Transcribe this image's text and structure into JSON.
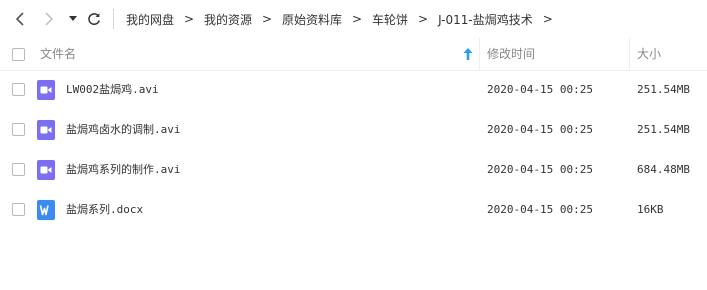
{
  "breadcrumb": [
    "我的网盘",
    "我的资源",
    "原始资料库",
    "车轮饼",
    "J-011-盐焗鸡技术"
  ],
  "breadcrumb_separator": ">",
  "columns": {
    "name": "文件名",
    "modified": "修改时间",
    "size": "大小"
  },
  "sort": {
    "column": "name",
    "direction": "ascending",
    "icon": "sort-up-arrow-icon"
  },
  "colors": {
    "video_icon": "#7b6ef0",
    "doc_icon": "#3b8cf2",
    "sort_arrow": "#2a9cf6"
  },
  "files": [
    {
      "name": "LW002盐焗鸡.avi",
      "modified": "2020-04-15 00:25",
      "size": "251.54MB",
      "icon": "video-file-icon"
    },
    {
      "name": "盐焗鸡卤水的调制.avi",
      "modified": "2020-04-15 00:25",
      "size": "251.54MB",
      "icon": "video-file-icon"
    },
    {
      "name": "盐焗鸡系列的制作.avi",
      "modified": "2020-04-15 00:25",
      "size": "684.48MB",
      "icon": "video-file-icon"
    },
    {
      "name": "盐焗系列.docx",
      "modified": "2020-04-15 00:25",
      "size": "16KB",
      "icon": "word-doc-icon"
    }
  ]
}
